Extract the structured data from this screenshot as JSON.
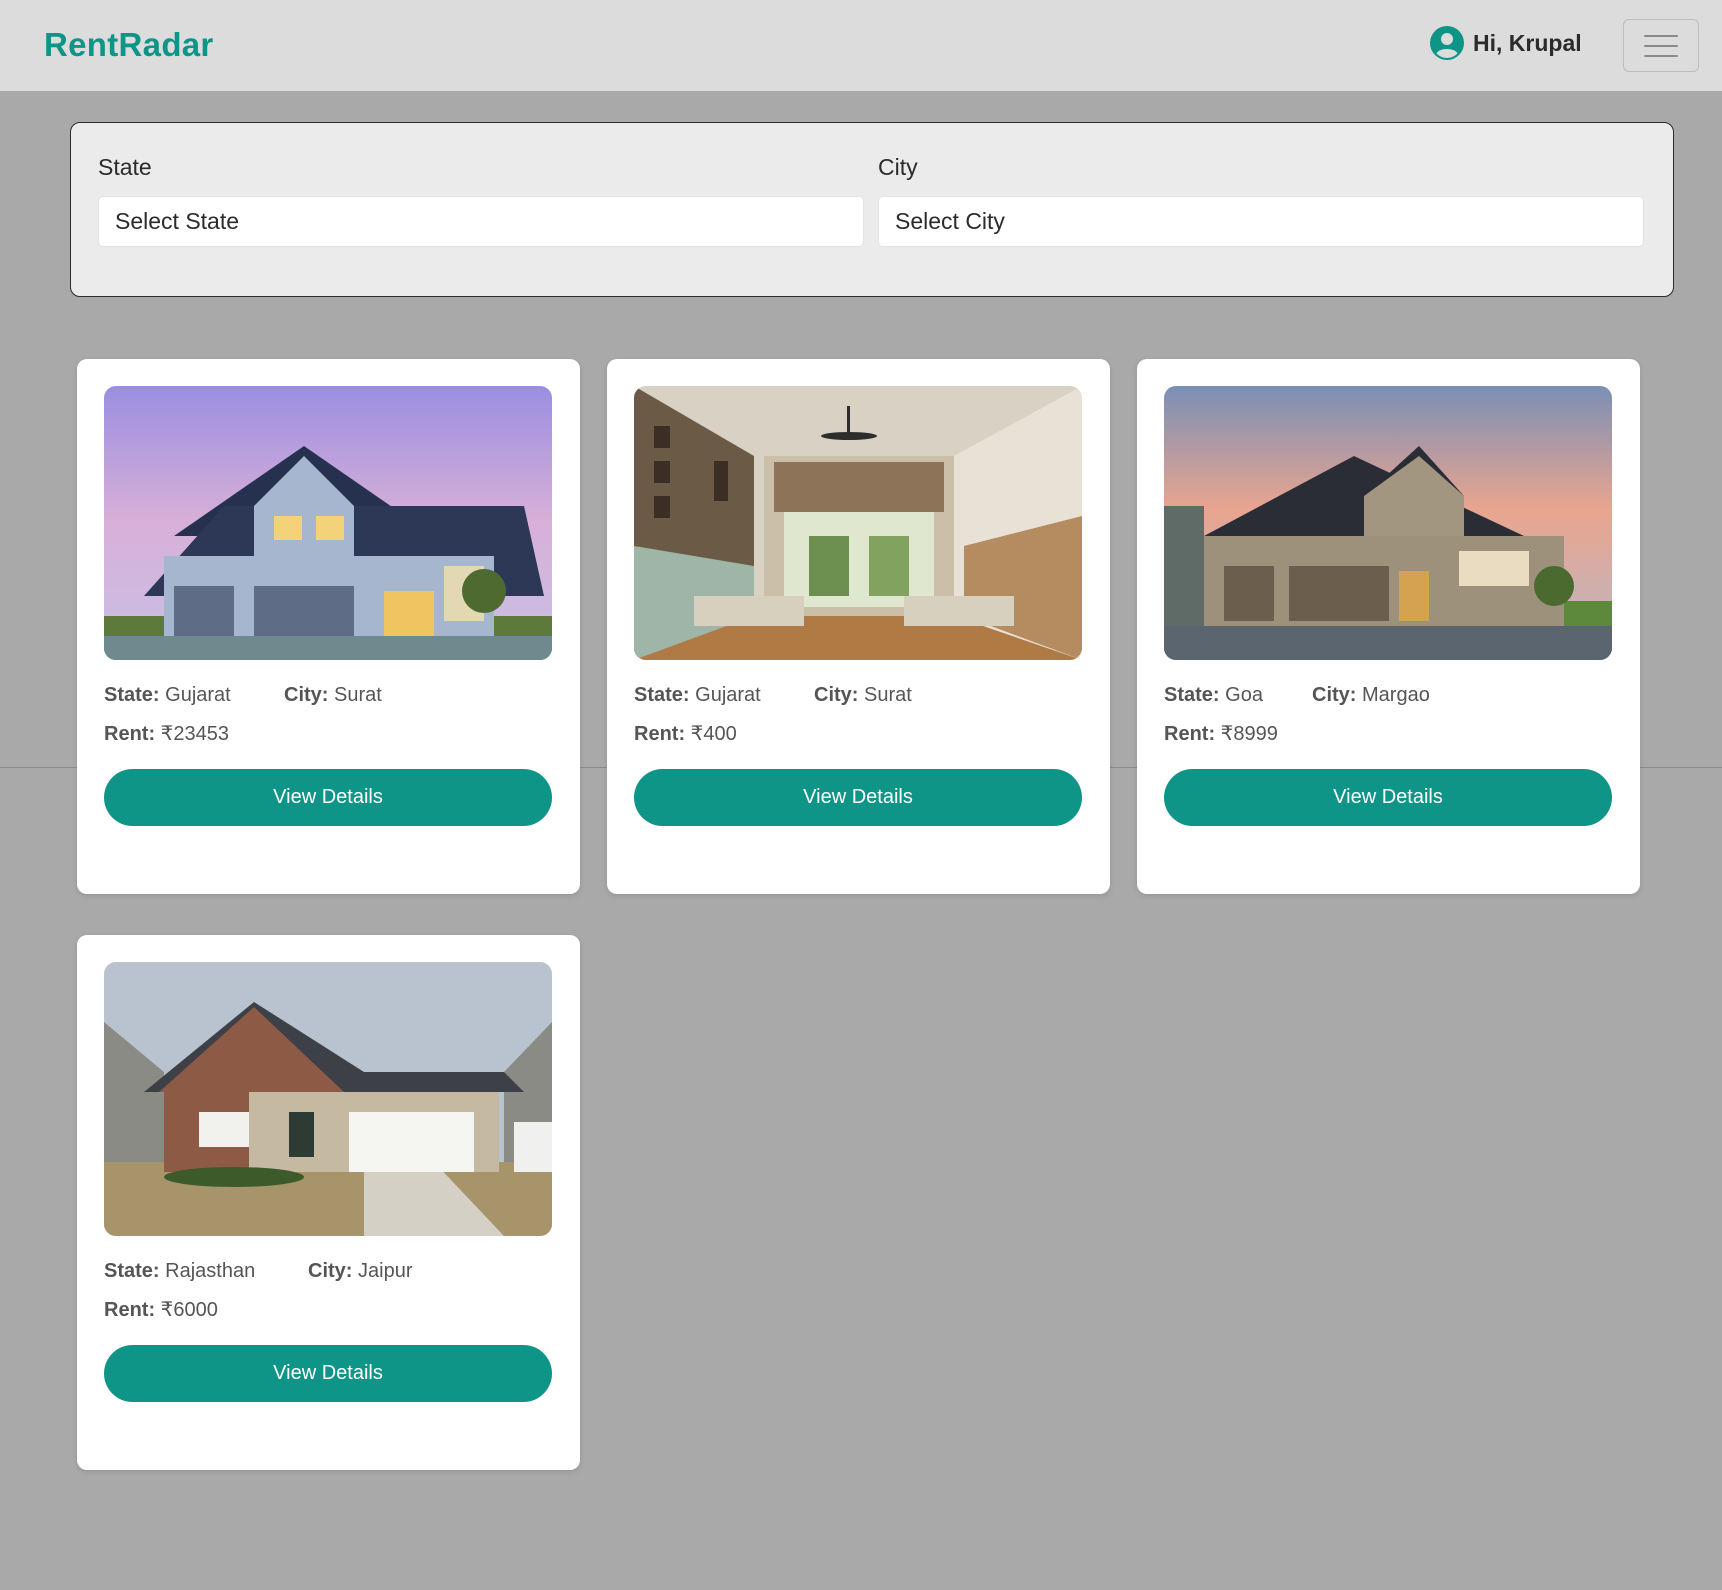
{
  "header": {
    "brand": "RentRadar",
    "greeting": "Hi, Krupal",
    "brand_color": "#0f9488"
  },
  "filters": {
    "state_label": "State",
    "state_value": "Select State",
    "city_label": "City",
    "city_value": "Select City"
  },
  "labels": {
    "state": "State:",
    "city": "City:",
    "rent": "Rent:",
    "button": "View Details"
  },
  "listings": [
    {
      "state": "Gujarat",
      "city": "Surat",
      "rent": "₹23453",
      "image": "blue-two-story-house-photo"
    },
    {
      "state": "Gujarat",
      "city": "Surat",
      "rent": "₹400",
      "image": "bedroom-interior-photo"
    },
    {
      "state": "Goa",
      "city": "Margao",
      "rent": "₹8999",
      "image": "grey-house-dusk-photo"
    },
    {
      "state": "Rajasthan",
      "city": "Jaipur",
      "rent": "₹6000",
      "image": "brick-ranch-house-photo"
    }
  ]
}
